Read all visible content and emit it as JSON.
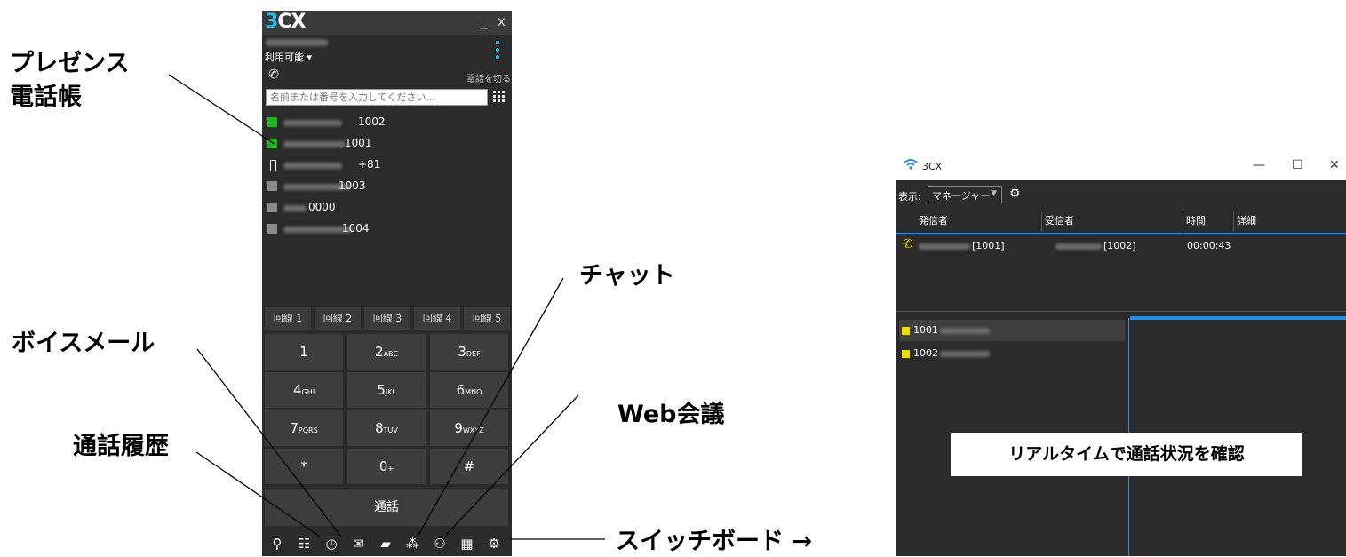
{
  "callouts": {
    "presence": "プレゼンス",
    "phonebook": "電話帳",
    "voicemail": "ボイスメール",
    "history": "通話履歴",
    "chat": "チャット",
    "web_meeting": "Web会議",
    "switchboard": "スイッチボード →"
  },
  "phone": {
    "logo_three": "3",
    "logo_cx": "CX",
    "minimize": "_",
    "close": "x",
    "presence_status": "利用可能 ▾",
    "hangup_label": "電話を切る",
    "search_placeholder": "名前または番号を入力してください...",
    "contacts": [
      {
        "num": "1002",
        "color": "#22b322"
      },
      {
        "num": "1001",
        "color": "#22b322"
      },
      {
        "num": "+81",
        "color": "mobile"
      },
      {
        "num": "1003",
        "color": "#8a8a8a"
      },
      {
        "num": "0000",
        "color": "#8a8a8a"
      },
      {
        "num": "1004",
        "color": "#8a8a8a"
      }
    ],
    "lines": [
      "回線 1",
      "回線 2",
      "回線 3",
      "回線 4",
      "回線 5"
    ],
    "keys": [
      {
        "d": "1",
        "s": ""
      },
      {
        "d": "2",
        "s": "ABC"
      },
      {
        "d": "3",
        "s": "DEF"
      },
      {
        "d": "4",
        "s": "GHI"
      },
      {
        "d": "5",
        "s": "JKL"
      },
      {
        "d": "6",
        "s": "MNO"
      },
      {
        "d": "7",
        "s": "PQRS"
      },
      {
        "d": "8",
        "s": "TUV"
      },
      {
        "d": "9",
        "s": "WXYZ"
      },
      {
        "d": "*",
        "s": ""
      },
      {
        "d": "0",
        "s": "+"
      },
      {
        "d": "#",
        "s": ""
      }
    ],
    "call_label": "通話",
    "toolbar_icons": [
      "add-contact-icon",
      "phonebook-icon",
      "history-icon",
      "voicemail-icon",
      "chat-icon",
      "conference-icon",
      "web-meeting-icon",
      "switchboard-icon",
      "settings-icon"
    ]
  },
  "switchboard": {
    "title": "3CX",
    "min": "—",
    "max": "☐",
    "close": "✕",
    "view_label": "表示:",
    "view_value": "マネージャー",
    "columns": [
      "発信者",
      "受信者",
      "時間",
      "詳細"
    ],
    "call": {
      "caller": "[1001]",
      "callee": "[1002]",
      "time": "00:00:43"
    },
    "extensions": [
      "1001",
      "1002"
    ],
    "caption": "リアルタイムで通話状況を確認"
  }
}
